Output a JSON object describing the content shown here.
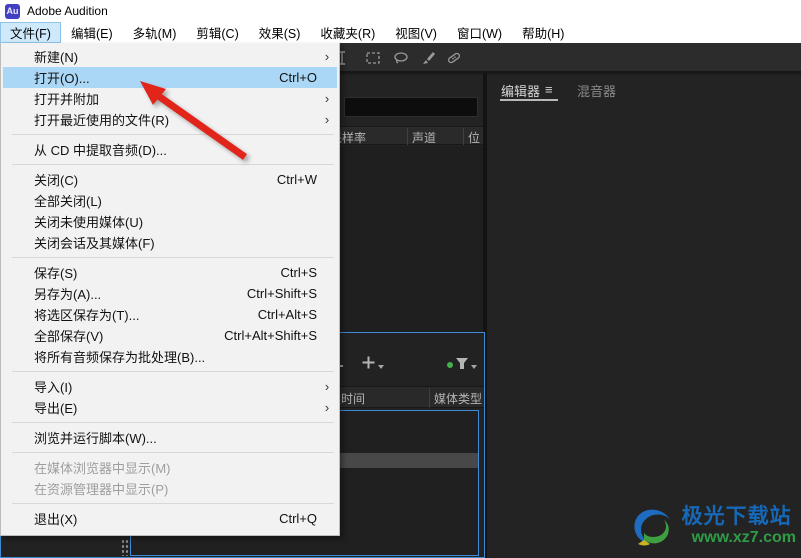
{
  "window": {
    "app_title": "Adobe Audition",
    "logo_text": "Au"
  },
  "menubar": {
    "items": [
      {
        "label": "文件(F)",
        "active": true
      },
      {
        "label": "编辑(E)"
      },
      {
        "label": "多轨(M)"
      },
      {
        "label": "剪辑(C)"
      },
      {
        "label": "效果(S)"
      },
      {
        "label": "收藏夹(R)"
      },
      {
        "label": "视图(V)"
      },
      {
        "label": "窗口(W)"
      },
      {
        "label": "帮助(H)"
      }
    ]
  },
  "file_menu": {
    "items": [
      {
        "label": "新建(N)",
        "submenu": true
      },
      {
        "label": "打开(O)...",
        "shortcut": "Ctrl+O",
        "highlighted": true
      },
      {
        "label": "打开并附加",
        "submenu": true
      },
      {
        "label": "打开最近使用的文件(R)",
        "submenu": true
      },
      {
        "type": "separator"
      },
      {
        "label": "从 CD 中提取音频(D)..."
      },
      {
        "type": "separator"
      },
      {
        "label": "关闭(C)",
        "shortcut": "Ctrl+W"
      },
      {
        "label": "全部关闭(L)"
      },
      {
        "label": "关闭未使用媒体(U)"
      },
      {
        "label": "关闭会话及其媒体(F)"
      },
      {
        "type": "separator"
      },
      {
        "label": "保存(S)",
        "shortcut": "Ctrl+S"
      },
      {
        "label": "另存为(A)...",
        "shortcut": "Ctrl+Shift+S"
      },
      {
        "label": "将选区保存为(T)...",
        "shortcut": "Ctrl+Alt+S"
      },
      {
        "label": "全部保存(V)",
        "shortcut": "Ctrl+Alt+Shift+S"
      },
      {
        "label": "将所有音频保存为批处理(B)..."
      },
      {
        "type": "separator"
      },
      {
        "label": "导入(I)",
        "submenu": true
      },
      {
        "label": "导出(E)",
        "submenu": true
      },
      {
        "type": "separator"
      },
      {
        "label": "浏览并运行脚本(W)..."
      },
      {
        "type": "separator"
      },
      {
        "label": "在媒体浏览器中显示(M)",
        "disabled": true
      },
      {
        "label": "在资源管理器中显示(P)",
        "disabled": true
      },
      {
        "type": "separator"
      },
      {
        "label": "退出(X)",
        "shortcut": "Ctrl+Q"
      }
    ]
  },
  "toolbar": {
    "icons": [
      "time-selection-icon",
      "marquee-selection-icon",
      "lasso-selection-icon",
      "paintbrush-icon",
      "healing-brush-icon"
    ]
  },
  "files_panel": {
    "search_value": "",
    "columns": [
      "采样率",
      "声道",
      "位"
    ]
  },
  "media_browser": {
    "icons": [
      "add-icon",
      "filter-icon"
    ],
    "columns": [
      "持续时间",
      "媒体类型"
    ]
  },
  "editor_panel": {
    "tabs": [
      {
        "label": "编辑器",
        "active": true
      },
      {
        "label": "混音器",
        "active": false
      }
    ],
    "panel_menu_icon": "≡"
  },
  "watermark": {
    "site_name": "极光下载站",
    "site_url": "www.xz7.com"
  },
  "colors": {
    "focus_border_blue": "#3d8bd4",
    "menu_highlight_blue": "#a9d7f5",
    "menubar_highlight_blue": "#cde9fb",
    "arrow_red": "#e1251b",
    "watermark_blue": "#1668b8",
    "watermark_green": "#2f9d47",
    "au_logo_blue": "#4040c0"
  }
}
